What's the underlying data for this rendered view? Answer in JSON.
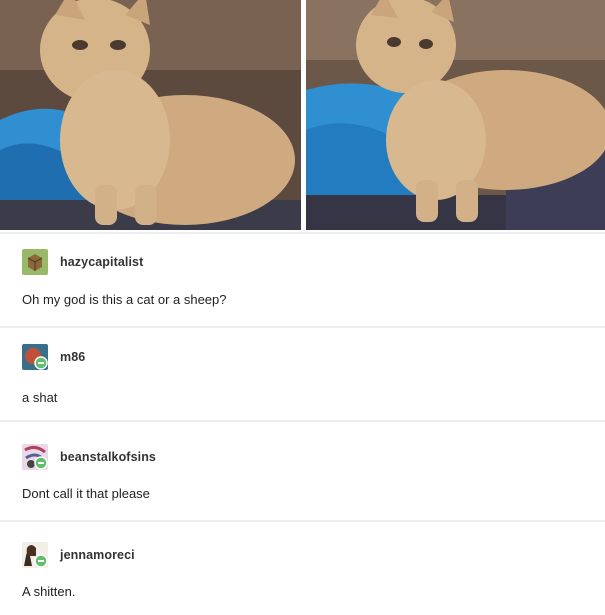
{
  "image": {
    "left_alt": "curly-haired kitten sitting on blue blanket, looking up",
    "right_alt": "curly-haired kitten sitting on blue blanket, side view"
  },
  "comments": [
    {
      "username": "hazycapitalist",
      "text": "Oh my god is this a cat or a sheep?",
      "avatar_icon": "box-avatar-icon"
    },
    {
      "username": "m86",
      "text": "a shat",
      "avatar_icon": "planet-avatar-icon"
    },
    {
      "username": "beanstalkofsins",
      "text": "Dont call it that please",
      "avatar_icon": "swirl-avatar-icon"
    },
    {
      "username": "jennamoreci",
      "text": "A shitten.",
      "avatar_icon": "portrait-avatar-icon"
    }
  ],
  "colors": {
    "blanket_blue": "#2f8fd0",
    "kitten_fur": "#d6b48a",
    "badge_green": "#5fbf6a"
  }
}
